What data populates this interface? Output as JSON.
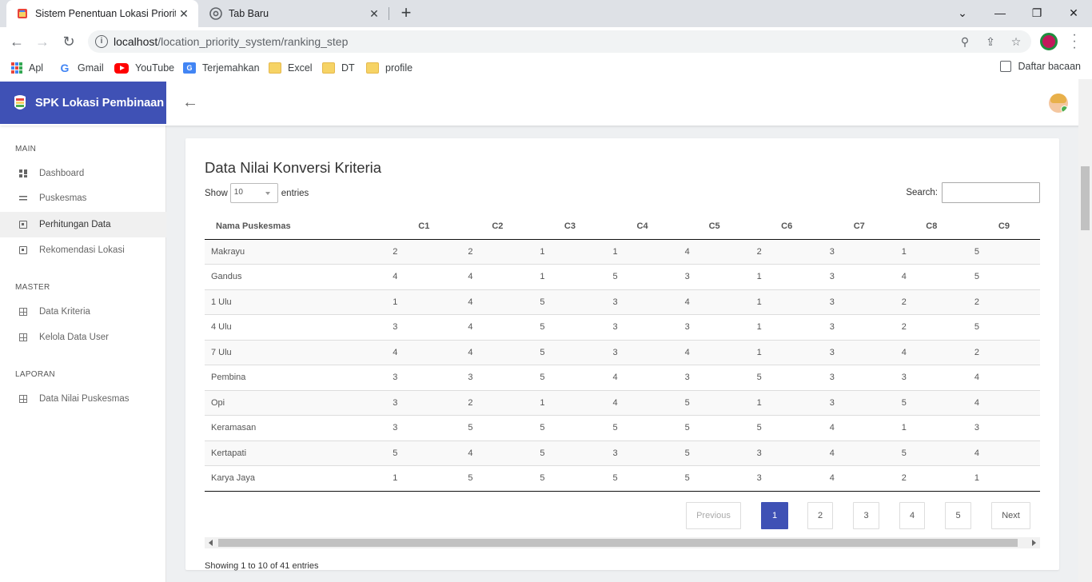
{
  "browser": {
    "active_tab_title": "Sistem Penentuan Lokasi Priorita",
    "inactive_tab_title": "Tab Baru",
    "url_host": "localhost",
    "url_path": "/location_priority_system/ranking_step",
    "bookmarks": [
      "Apl",
      "Gmail",
      "YouTube",
      "Terjemahkan",
      "Excel",
      "DT",
      "profile"
    ],
    "reading_list": "Daftar bacaan"
  },
  "app": {
    "brand_name": "SPK Lokasi Pembinaan",
    "colors": {
      "primary": "#3f51b5"
    }
  },
  "sidebar": {
    "sections": [
      {
        "title": "MAIN",
        "items": [
          "Dashboard",
          "Puskesmas",
          "Perhitungan Data",
          "Rekomendasi Lokasi"
        ]
      },
      {
        "title": "MASTER",
        "items": [
          "Data Kriteria",
          "Kelola Data User"
        ]
      },
      {
        "title": "LAPORAN",
        "items": [
          "Data Nilai Puskesmas"
        ]
      }
    ],
    "active_item": "Perhitungan Data"
  },
  "card": {
    "title": "Data Nilai Konversi Kriteria",
    "show_label": "Show",
    "page_length": "10",
    "entries_label": "entries",
    "search_label": "Search:",
    "search_value": "",
    "columns": [
      "Nama Puskesmas",
      "C1",
      "C2",
      "C3",
      "C4",
      "C5",
      "C6",
      "C7",
      "C8",
      "C9"
    ],
    "rows": [
      [
        "Makrayu",
        "2",
        "2",
        "1",
        "1",
        "4",
        "2",
        "3",
        "1",
        "5"
      ],
      [
        "Gandus",
        "4",
        "4",
        "1",
        "5",
        "3",
        "1",
        "3",
        "4",
        "5"
      ],
      [
        "1 Ulu",
        "1",
        "4",
        "5",
        "3",
        "4",
        "1",
        "3",
        "2",
        "2"
      ],
      [
        "4 Ulu",
        "3",
        "4",
        "5",
        "3",
        "3",
        "1",
        "3",
        "2",
        "5"
      ],
      [
        "7 Ulu",
        "4",
        "4",
        "5",
        "3",
        "4",
        "1",
        "3",
        "4",
        "2"
      ],
      [
        "Pembina",
        "3",
        "3",
        "5",
        "4",
        "3",
        "5",
        "3",
        "3",
        "4"
      ],
      [
        "Opi",
        "3",
        "2",
        "1",
        "4",
        "5",
        "1",
        "3",
        "5",
        "4"
      ],
      [
        "Keramasan",
        "3",
        "5",
        "5",
        "5",
        "5",
        "5",
        "4",
        "1",
        "3"
      ],
      [
        "Kertapati",
        "5",
        "4",
        "5",
        "3",
        "5",
        "3",
        "4",
        "5",
        "4"
      ],
      [
        "Karya Jaya",
        "1",
        "5",
        "5",
        "5",
        "5",
        "3",
        "4",
        "2",
        "1"
      ]
    ],
    "pagination": {
      "previous": "Previous",
      "pages": [
        "1",
        "2",
        "3",
        "4",
        "5"
      ],
      "current": "1",
      "next": "Next"
    },
    "info": "Showing 1 to 10 of 41 entries"
  }
}
